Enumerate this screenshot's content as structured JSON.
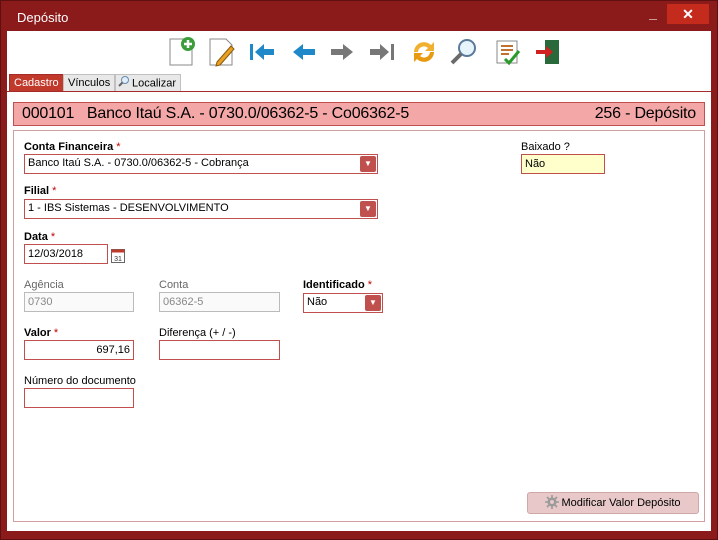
{
  "window": {
    "title": "Depósito",
    "minimize": "_",
    "close": "✕"
  },
  "toolbar": {
    "icons": [
      "new-doc-icon",
      "edit-doc-icon",
      "first-record-icon",
      "prev-record-icon",
      "next-record-icon",
      "last-record-icon",
      "refresh-icon",
      "search-icon",
      "checklist-icon",
      "exit-icon"
    ]
  },
  "tabs": [
    {
      "label": "Cadastro",
      "active": true
    },
    {
      "label": "Vínculos",
      "active": false
    },
    {
      "label": "Localizar",
      "active": false
    }
  ],
  "header": {
    "left": "000101   Banco Itaú S.A. - 0730.0/06362-5 - Co06362-5",
    "right": "256 - Depósito"
  },
  "form": {
    "conta_financeira": {
      "label": "Conta Financeira",
      "required": "*",
      "value": "Banco Itaú S.A. - 0730.0/06362-5 - Cobrança"
    },
    "baixado": {
      "label": "Baixado ?",
      "value": "Não"
    },
    "filial": {
      "label": "Filial",
      "required": "*",
      "value": "1 - IBS Sistemas - DESENVOLVIMENTO"
    },
    "data": {
      "label": "Data",
      "required": "*",
      "value": "12/03/2018",
      "calendar_day": "31"
    },
    "agencia": {
      "label": "Agência",
      "value": "0730"
    },
    "conta": {
      "label": "Conta",
      "value": "06362-5"
    },
    "identificado": {
      "label": "Identificado",
      "required": "*",
      "value": "Não"
    },
    "valor": {
      "label": "Valor",
      "required": "*",
      "value": "697,16"
    },
    "diferenca": {
      "label": "Diferença (+ / -)",
      "value": ""
    },
    "numero_documento": {
      "label": "Número do documento",
      "value": ""
    }
  },
  "actions": {
    "modify_label": "Modificar Valor Depósito"
  },
  "colors": {
    "frame": "#8b1a1a",
    "accent": "#c0504d",
    "header_bg": "#f4a7a7",
    "active_tab": "#c0392b"
  }
}
